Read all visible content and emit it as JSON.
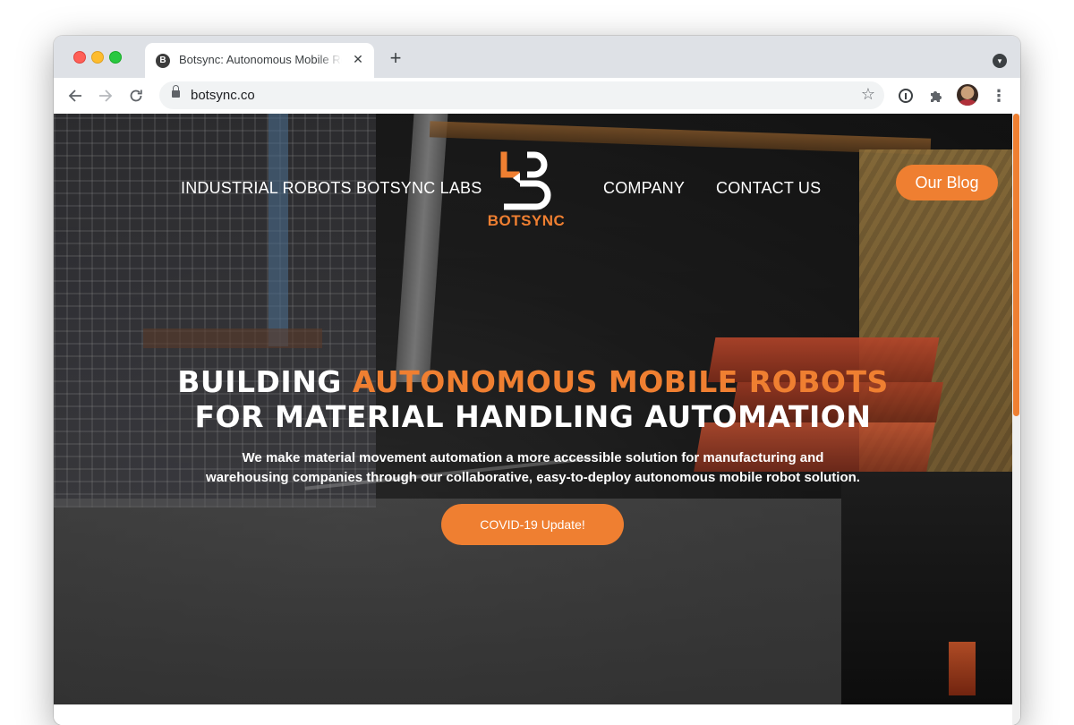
{
  "browser": {
    "tab": {
      "title": "Botsync: Autonomous Mobile Robots",
      "favicon_letter": "B",
      "close": "✕"
    },
    "new_tab": "+",
    "url": "botsync.co",
    "icons": {
      "back": "arrow-left",
      "forward": "arrow-right",
      "reload": "reload",
      "star": "star",
      "extension": "puzzle",
      "menu": "more-vert"
    }
  },
  "site": {
    "brand_color": "#ef7f31",
    "nav": {
      "industrial_robots": "INDUSTRIAL ROBOTS",
      "botsync_labs": "BOTSYNC LABS",
      "company": "COMPANY",
      "contact_us": "CONTACT US"
    },
    "logo_text": "BOTSYNC",
    "blog_button": "Our Blog",
    "headline": {
      "part1": "BUILDING ",
      "accent": "AUTONOMOUS MOBILE ROBOTS",
      "line2": "FOR MATERIAL HANDLING AUTOMATION"
    },
    "subtext_line1": "We make material movement automation a more accessible solution for manufacturing and",
    "subtext_line2": "warehousing companies through our collaborative, easy-to-deploy autonomous mobile robot solution.",
    "cta": "COVID-19 Update!"
  }
}
